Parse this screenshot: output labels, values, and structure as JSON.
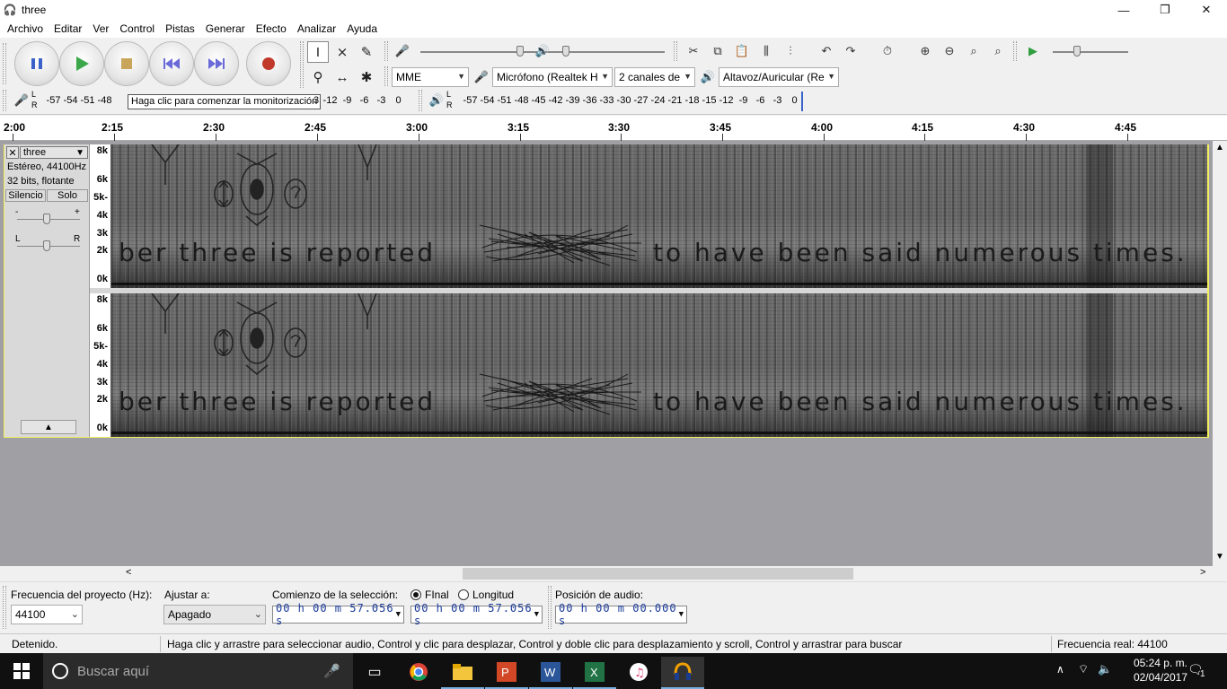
{
  "window": {
    "title": "three"
  },
  "menu": [
    "Archivo",
    "Editar",
    "Ver",
    "Control",
    "Pistas",
    "Generar",
    "Efecto",
    "Analizar",
    "Ayuda"
  ],
  "device": {
    "host": "MME",
    "input": "Micrófono (Realtek H",
    "channels": "2 canales de",
    "output": "Altavoz/Auricular (Re"
  },
  "meters": {
    "record_scale": [
      "-57",
      "-54",
      "-51",
      "-48"
    ],
    "record_scale_tail": [
      "3",
      "-12",
      "-9",
      "-6",
      "-3",
      "0"
    ],
    "tooltip": "Haga clic para comenzar la monitorización",
    "play_scale": [
      "-57",
      "-54",
      "-51",
      "-48",
      "-45",
      "-42",
      "-39",
      "-36",
      "-33",
      "-30",
      "-27",
      "-24",
      "-21",
      "-18",
      "-15",
      "-12",
      "-9",
      "-6",
      "-3",
      "0"
    ],
    "lr_top": "L",
    "lr_bottom": "R"
  },
  "timeline": {
    "ticks": [
      "2:00",
      "2:15",
      "2:30",
      "2:45",
      "3:00",
      "3:15",
      "3:30",
      "3:45",
      "4:00",
      "4:15",
      "4:30",
      "4:45"
    ]
  },
  "track": {
    "name": "three",
    "format": "Estéreo, 44100Hz",
    "bits": "32 bits, flotante",
    "mute": "Silencio",
    "solo": "Solo",
    "gain_min": "-",
    "gain_max": "+",
    "pan_l": "L",
    "pan_r": "R",
    "freq_labels_top": [
      "8k",
      "6k",
      "5k-",
      "4k",
      "3k",
      "2k",
      "0k"
    ],
    "freq_labels_bottom": [
      "8k",
      "6k",
      "5k-",
      "4k",
      "3k",
      "2k",
      "0k"
    ],
    "spectro_text_a": "ber three is reported",
    "spectro_text_b": "to have been said numerous times."
  },
  "selection": {
    "rate_label": "Frecuencia del proyecto (Hz):",
    "rate_value": "44100",
    "snap_label": "Ajustar a:",
    "snap_value": "Apagado",
    "start_label": "Comienzo de la selección:",
    "end_radio": "FInal",
    "length_radio": "Longitud",
    "start_value": "00 h 00 m 57.056 s",
    "end_value": "00 h 00 m 57.056 s",
    "audio_pos_label": "Posición de audio:",
    "audio_pos_value": "00 h 00 m 00.000 s"
  },
  "status": {
    "state": "Detenido.",
    "hint": "Haga clic y arrastre para seleccionar audio, Control y clic para desplazar, Control y doble clic para desplazamiento y scroll, Control y arrastrar para buscar",
    "rate": "Frecuencia real: 44100"
  },
  "taskbar": {
    "search_placeholder": "Buscar aquí",
    "time": "05:24 p. m.",
    "date": "02/04/2017",
    "notifications": "1"
  },
  "colors": {
    "selection_border": "#f3ef5d",
    "record": "#c0392b",
    "play": "#2e9e3e"
  }
}
